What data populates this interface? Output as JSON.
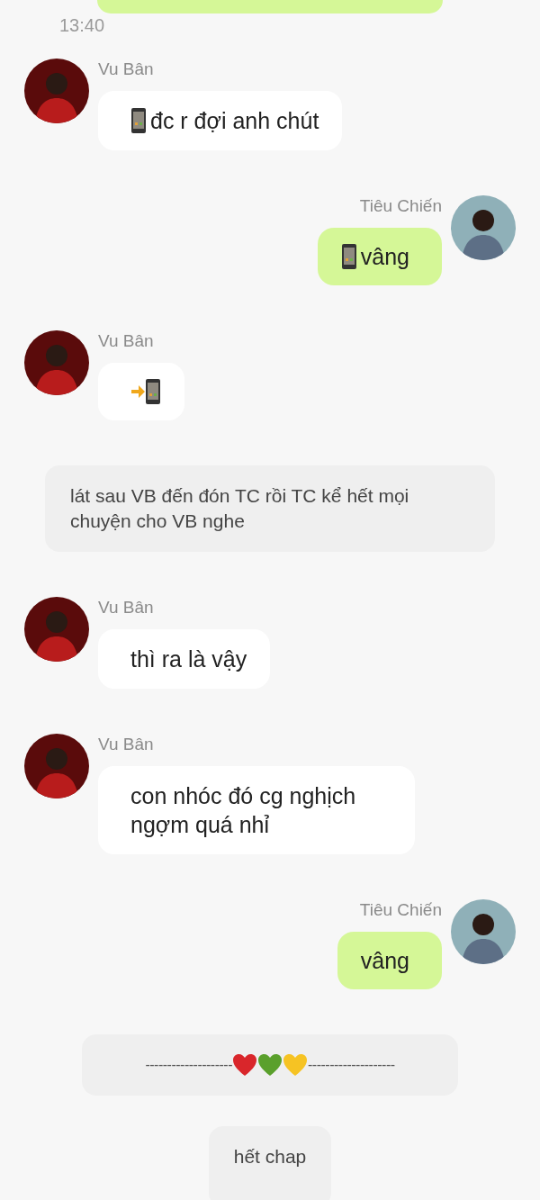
{
  "status_bar": {
    "time": "13:40"
  },
  "messages": [
    {
      "kind": "sent_partial"
    },
    {
      "kind": "received",
      "sender": "Vu Bân",
      "parts": [
        {
          "kind": "phone"
        },
        {
          "kind": "text",
          "text": "đc r đợi anh chút"
        }
      ]
    },
    {
      "kind": "sent",
      "sender": "Tiêu Chiến",
      "parts": [
        {
          "kind": "phone"
        },
        {
          "kind": "text",
          "text": "vâng"
        }
      ]
    },
    {
      "kind": "received",
      "sender": "Vu Bân",
      "parts": [
        {
          "kind": "phone_arrow"
        }
      ]
    },
    {
      "kind": "narration",
      "text": "lát sau VB đến đón TC rồi TC kể hết mọi chuyện cho VB nghe"
    },
    {
      "kind": "received",
      "sender": "Vu Bân",
      "parts": [
        {
          "kind": "text",
          "text": "thì ra là vậy"
        }
      ]
    },
    {
      "kind": "received",
      "sender": "Vu Bân",
      "parts": [
        {
          "kind": "text",
          "text": "con nhóc đó cg nghịch ngợm quá nhỉ"
        }
      ]
    },
    {
      "kind": "sent",
      "sender": "Tiêu Chiến",
      "parts": [
        {
          "kind": "text",
          "text": "vâng"
        }
      ]
    },
    {
      "kind": "separator",
      "left": "--------------------",
      "hearts": [
        {
          "color": "#d9262b"
        },
        {
          "color": "#5aa02c"
        },
        {
          "color": "#f6c323"
        }
      ],
      "right": "--------------------"
    },
    {
      "kind": "end",
      "text": "hết chap"
    }
  ]
}
